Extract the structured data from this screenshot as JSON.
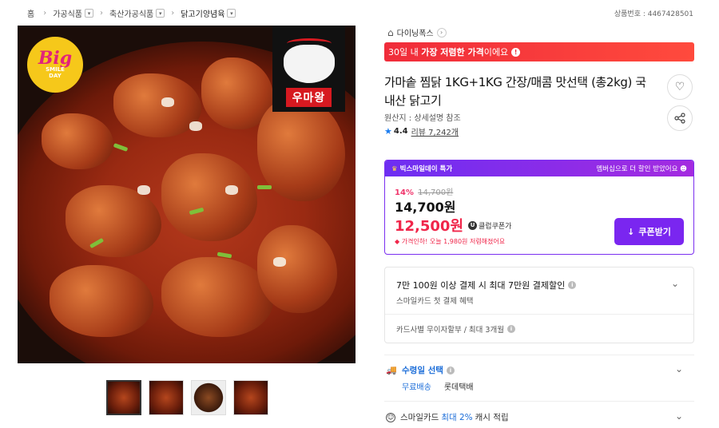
{
  "breadcrumb": [
    {
      "label": "홈",
      "has_dropdown": false
    },
    {
      "label": "가공식품",
      "has_dropdown": true
    },
    {
      "label": "축산가공식품",
      "has_dropdown": true
    },
    {
      "label": "닭고기양념육",
      "has_dropdown": true
    }
  ],
  "product_number": "상품번호 : 4467428501",
  "image": {
    "badge_big": "Big",
    "badge_sub1": "SMILE",
    "badge_sub2": "DAY",
    "logo_text": "우마왕",
    "thumbnail_count": 4
  },
  "shop": {
    "name": "다이닝폭스"
  },
  "price_banner": {
    "part1": "30일 내 ",
    "bold": "가장 저렴한 가격",
    "part2": "이에요"
  },
  "title": "가마솥 찜닭 1KG+1KG 간장/매콤 맛선택 (총2kg) 국내산 닭고기",
  "origin": "원산지 : 상세설명 참조",
  "rating": {
    "score": "4.4",
    "reviews": "리뷰 7,242개"
  },
  "promo": {
    "header_left": "빅스마일데이 특가",
    "header_right": "멤버십으로 더 할인 받았어요",
    "discount_pct": "14%",
    "original_price": "14,700원",
    "price": "14,700원",
    "club_price": "12,500원",
    "club_label": "클럽쿠폰가",
    "drop_note": "가격인하! 오늘 1,980원 저렴해졌어요",
    "coupon_button": "쿠폰받기"
  },
  "card": {
    "title": "7만 100원 이상 결제 시 최대 7만원 결제할인",
    "subtitle": "스마일카드 첫 결제 혜택",
    "installment": "카드사별 무이자할부 / 최대 3개월"
  },
  "shipping": {
    "label": "수령일 선택",
    "free": "무료배송",
    "carrier": "롯데택배"
  },
  "smilecash": {
    "pre": "스마일카드",
    "highlight": "최대 2%",
    "post": "캐시 적립"
  },
  "colors": {
    "accent_purple": "#7a26f0",
    "price_red": "#f0264a",
    "link_blue": "#1a6cd8"
  }
}
